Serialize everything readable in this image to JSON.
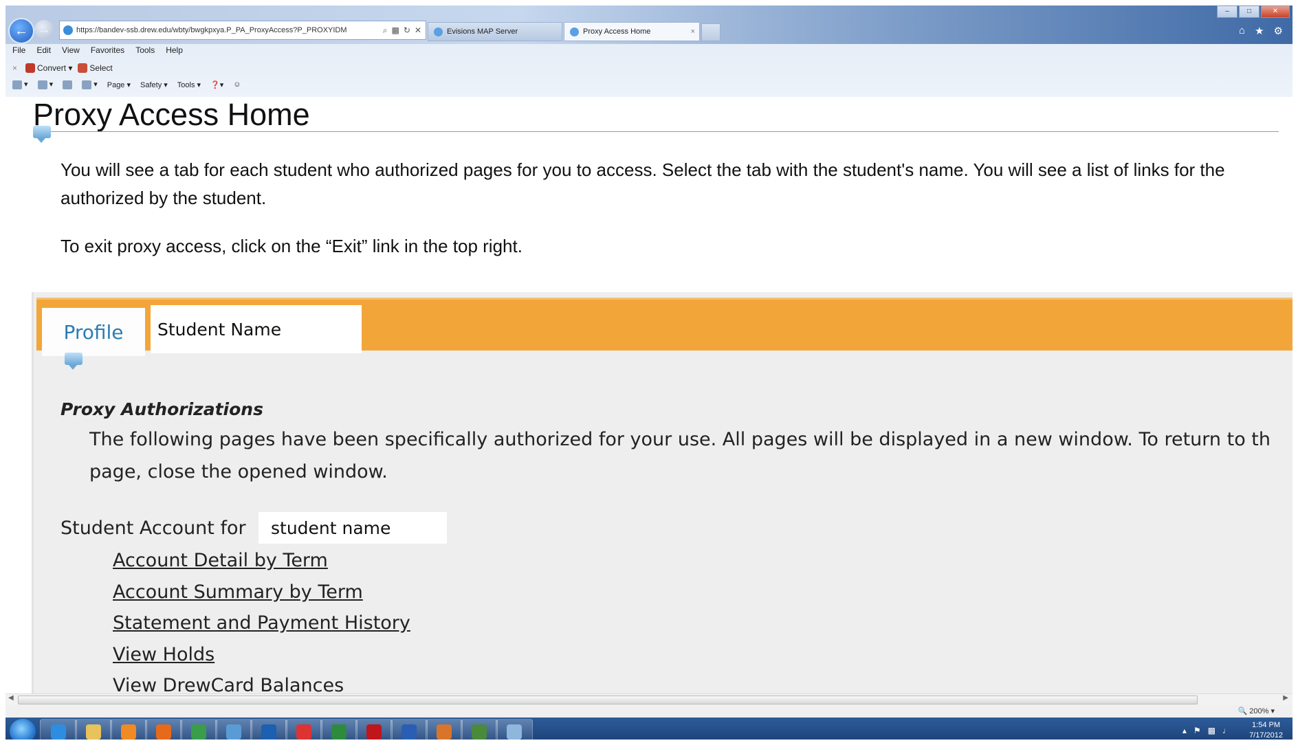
{
  "browser": {
    "url": "https://bandev-ssb.drew.edu/wbty/bwgkpxya.P_PA_ProxyAccess?P_PROXYIDM",
    "tabs": [
      {
        "label": "Evisions MAP Server"
      },
      {
        "label": "Proxy Access Home"
      }
    ],
    "menu": [
      "File",
      "Edit",
      "View",
      "Favorites",
      "Tools",
      "Help"
    ],
    "command_bar": {
      "convert": "Convert",
      "select": "Select"
    },
    "toolbar": {
      "page": "Page",
      "safety": "Safety",
      "tools": "Tools"
    }
  },
  "page": {
    "title": "Proxy Access Home",
    "info_line_1": "You will see a tab for each student who authorized pages for you to access. Select the tab with the student's name. You will see a list of links for the",
    "info_line_2": "authorized by the student.",
    "info_exit": "To exit proxy access, click on the “Exit” link in the top right.",
    "tabs": {
      "profile": "Profile",
      "student": "Student Name"
    },
    "section_title": "Proxy Authorizations",
    "auth_line_1": "The following pages have been specifically authorized for your use. All pages will be displayed in a new window. To return to th",
    "auth_line_2": "page, close the opened window.",
    "account_label": "Student Account for",
    "account_name": "student name",
    "links": [
      "Account Detail by Term",
      "Account Summary by Term",
      "Statement and Payment History",
      "View Holds",
      "View DrewCard Balances"
    ]
  },
  "status": {
    "zoom": "200%"
  },
  "taskbar": {
    "time": "1:54 PM",
    "date": "7/17/2012",
    "apps": [
      "internet-explorer",
      "file-explorer",
      "media-player",
      "firefox",
      "chrome",
      "photo-gallery",
      "app-a",
      "app-n",
      "excel",
      "acrobat",
      "word",
      "java",
      "app-server",
      "app-doc"
    ],
    "app_colors": [
      "#2f8de0",
      "#e8c25a",
      "#f08a24",
      "#e66a1a",
      "#3a9d4a",
      "#5b9bd5",
      "#1d5fb0",
      "#d33",
      "#2e8b3d",
      "#c0151b",
      "#2a5eb3",
      "#d8752a",
      "#4a8a3a",
      "#8fb6dd"
    ]
  }
}
